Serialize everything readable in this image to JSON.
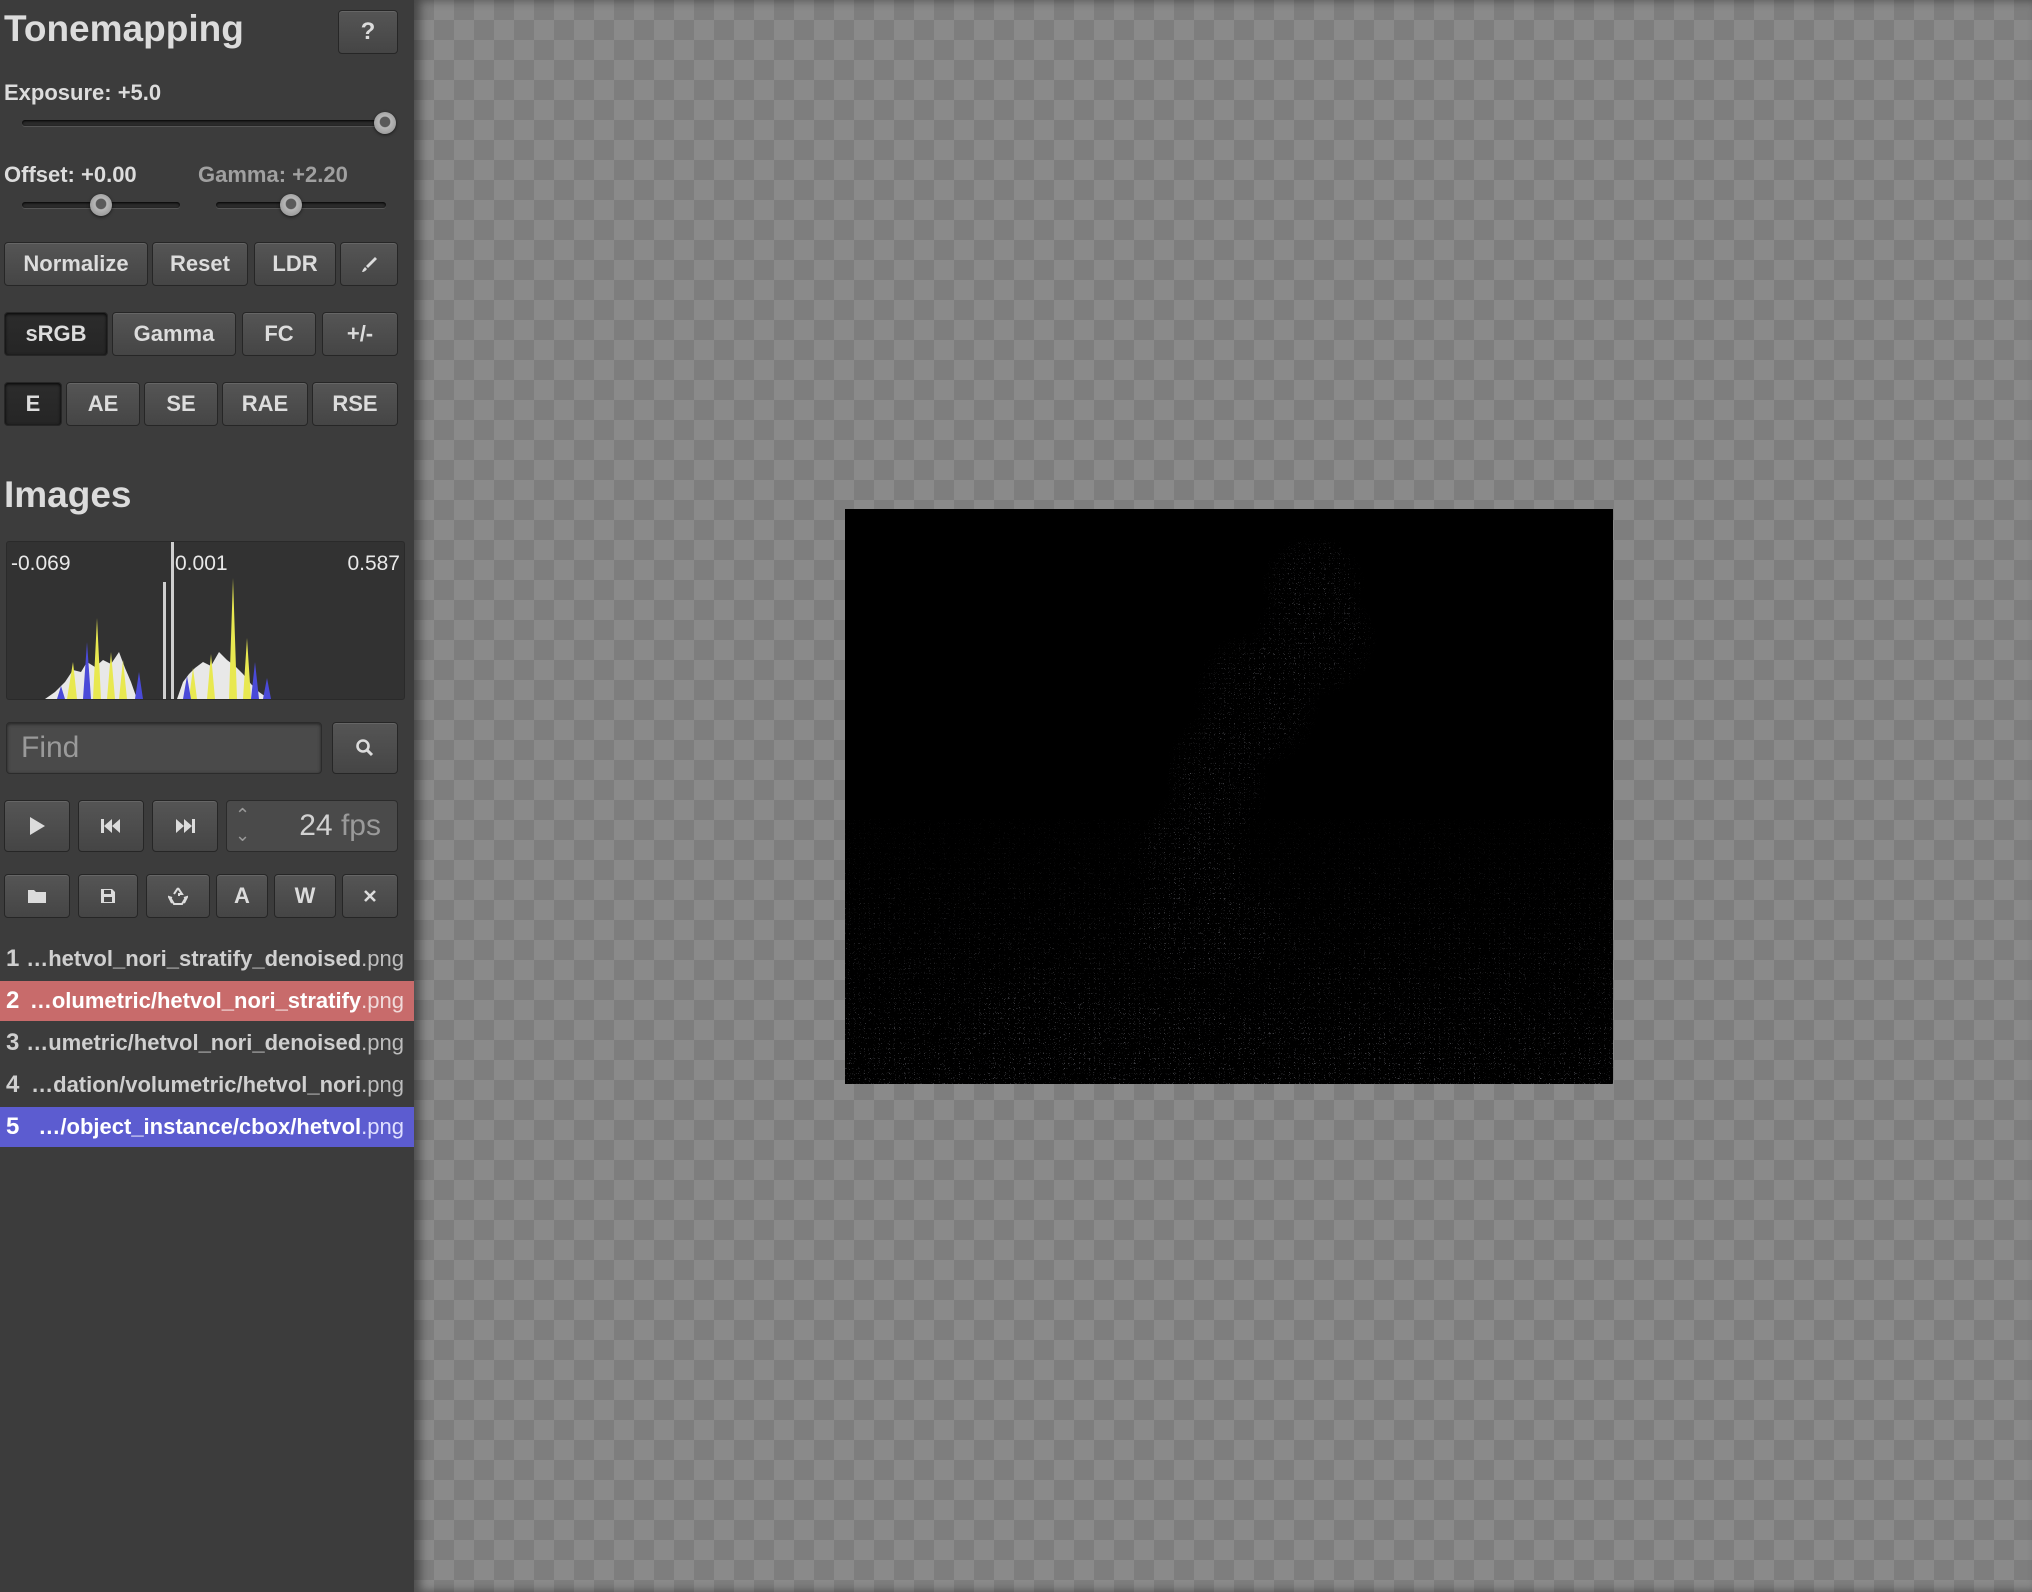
{
  "tonemapping": {
    "title": "Tonemapping",
    "help_label": "?",
    "exposure_label": "Exposure: +5.0",
    "exposure_value": 5.0,
    "offset_label": "Offset: +0.00",
    "offset_value": 0.0,
    "gamma_label": "Gamma: +2.20",
    "gamma_value": 2.2,
    "buttons": {
      "normalize": "Normalize",
      "reset": "Reset",
      "ldr": "LDR"
    },
    "modes": [
      "sRGB",
      "Gamma",
      "FC",
      "+/-"
    ],
    "active_mode": "sRGB",
    "error_metrics": [
      "E",
      "AE",
      "SE",
      "RAE",
      "RSE"
    ],
    "active_metric": "E"
  },
  "images": {
    "title": "Images",
    "histogram": {
      "min": "-0.069",
      "mid": "0.001",
      "max": "0.587"
    },
    "find_placeholder": "Find",
    "fps": {
      "value": "24",
      "unit": "fps"
    },
    "list": [
      {
        "num": "1",
        "name": "…hetvol_nori_stratify_denoised",
        "ext": ".png",
        "state": "normal"
      },
      {
        "num": "2",
        "name": "…olumetric/hetvol_nori_stratify",
        "ext": ".png",
        "state": "reference"
      },
      {
        "num": "3",
        "name": "…umetric/hetvol_nori_denoised",
        "ext": ".png",
        "state": "normal"
      },
      {
        "num": "4",
        "name": "…dation/volumetric/hetvol_nori",
        "ext": ".png",
        "state": "normal"
      },
      {
        "num": "5",
        "name": "…/object_instance/cbox/hetvol",
        "ext": ".png",
        "state": "current"
      }
    ]
  },
  "colors": {
    "sidebar_bg": "#3c3c3c",
    "reference_row": "#c86b6b",
    "current_row": "#5c5cd0",
    "histogram_yellow": "#e8e850",
    "histogram_blue": "#4a4ad8"
  },
  "icons": {
    "brush": "paint-brush-icon",
    "search": "search-icon",
    "play": "play-icon",
    "prev": "skip-back-icon",
    "next": "skip-forward-icon",
    "open": "folder-icon",
    "save": "save-icon",
    "reload": "recycle-icon",
    "close": "close-icon"
  }
}
